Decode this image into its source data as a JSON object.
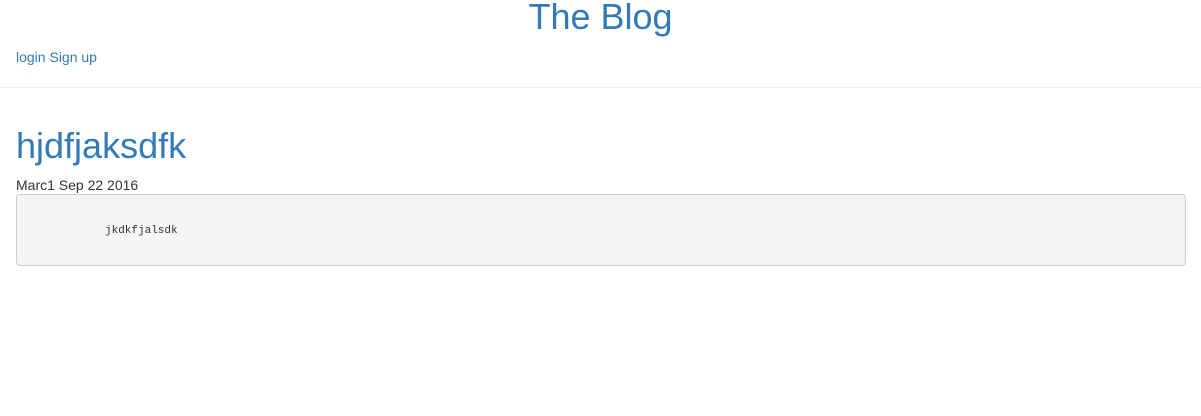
{
  "header": {
    "site_title": "The Blog",
    "nav": {
      "login": "login",
      "signup": "Sign up"
    }
  },
  "post": {
    "title": "hjdfjaksdfk",
    "author": "Marc1",
    "date": "Sep 22 2016",
    "body": "jkdkfjalsdk"
  }
}
